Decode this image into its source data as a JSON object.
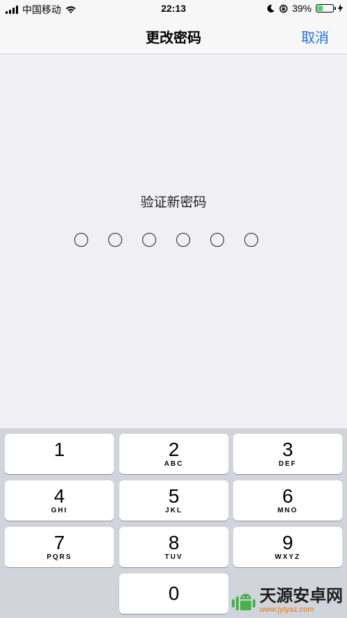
{
  "status_bar": {
    "carrier": "中国移动",
    "time": "22:13",
    "battery_percent": "39%",
    "battery_level": 0.39
  },
  "navbar": {
    "title": "更改密码",
    "cancel_label": "取消"
  },
  "passcode": {
    "prompt": "验证新密码",
    "length": 6,
    "entered": 0
  },
  "keypad": {
    "keys": [
      {
        "num": "1",
        "letters": ""
      },
      {
        "num": "2",
        "letters": "ABC"
      },
      {
        "num": "3",
        "letters": "DEF"
      },
      {
        "num": "4",
        "letters": "GHI"
      },
      {
        "num": "5",
        "letters": "JKL"
      },
      {
        "num": "6",
        "letters": "MNO"
      },
      {
        "num": "7",
        "letters": "PQRS"
      },
      {
        "num": "8",
        "letters": "TUV"
      },
      {
        "num": "9",
        "letters": "WXYZ"
      },
      {
        "num": "0",
        "letters": ""
      }
    ]
  },
  "watermark": {
    "title": "天源安卓网",
    "url": "www.jytyaz.com"
  },
  "colors": {
    "accent": "#1f6fe0",
    "battery_fill": "#4cd964",
    "keypad_bg": "#d1d5db"
  }
}
